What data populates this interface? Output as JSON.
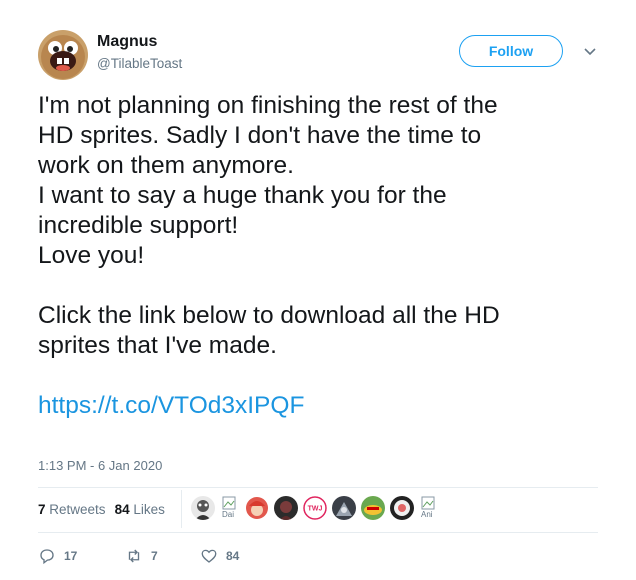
{
  "user": {
    "display_name": "Magnus",
    "handle": "@TilableToast",
    "avatar_icon": "cartoon-face-avatar"
  },
  "follow_label": "Follow",
  "menu_icon": "chevron-down-icon",
  "tweet": {
    "lines": [
      "I'm not planning on finishing the rest of the",
      "HD sprites. Sadly I don't have the time to",
      "work on them anymore.",
      "I want to say a huge thank you for the",
      "incredible support!",
      "Love you!",
      "",
      "Click the link below to download all the HD",
      "sprites that I've made.",
      ""
    ],
    "link": "https://t.co/VTOd3xIPQF",
    "timestamp": "1:13 PM - 6 Jan 2020"
  },
  "stats": {
    "retweets_count": "7",
    "retweets_label": "Retweets",
    "likes_count": "84",
    "likes_label": "Likes"
  },
  "likers": {
    "broken_1_alt": "Dai",
    "broken_2_alt": "Ani",
    "badge_text": "TWJ"
  },
  "actions": {
    "replies": "17",
    "retweets": "7",
    "likes": "84"
  },
  "colors": {
    "accent": "#1da1f2",
    "link": "#1b95e0",
    "secondary_text": "#657786",
    "primary_text": "#14171a"
  }
}
